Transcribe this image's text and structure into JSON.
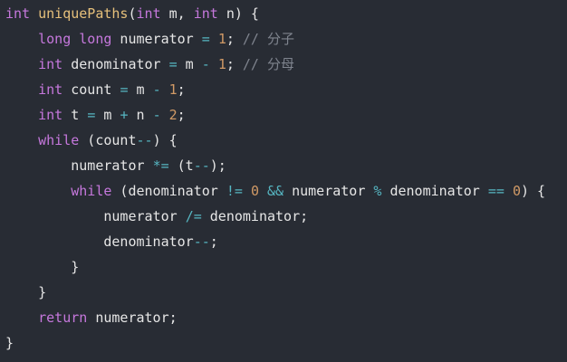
{
  "editor": {
    "language": "cpp",
    "colors": {
      "background": "#282c34",
      "keyword": "#c678dd",
      "function": "#e6c07b",
      "number": "#d19a66",
      "operator": "#56b6c2",
      "comment": "#7f848e",
      "plain": "#e6e6e6"
    },
    "lines": [
      {
        "indent": 0,
        "tokens": [
          {
            "t": "int",
            "c": "kw"
          },
          {
            "t": " ",
            "c": "pl"
          },
          {
            "t": "uniquePaths",
            "c": "fn"
          },
          {
            "t": "(",
            "c": "pl"
          },
          {
            "t": "int",
            "c": "kw"
          },
          {
            "t": " m, ",
            "c": "pl"
          },
          {
            "t": "int",
            "c": "kw"
          },
          {
            "t": " n) {",
            "c": "pl"
          }
        ]
      },
      {
        "indent": 1,
        "tokens": [
          {
            "t": "long",
            "c": "kw"
          },
          {
            "t": " ",
            "c": "pl"
          },
          {
            "t": "long",
            "c": "kw"
          },
          {
            "t": " numerator ",
            "c": "pl"
          },
          {
            "t": "=",
            "c": "op"
          },
          {
            "t": " ",
            "c": "pl"
          },
          {
            "t": "1",
            "c": "num"
          },
          {
            "t": "; ",
            "c": "pl"
          },
          {
            "t": "// 分子",
            "c": "cm"
          }
        ]
      },
      {
        "indent": 1,
        "tokens": [
          {
            "t": "int",
            "c": "kw"
          },
          {
            "t": " denominator ",
            "c": "pl"
          },
          {
            "t": "=",
            "c": "op"
          },
          {
            "t": " m ",
            "c": "pl"
          },
          {
            "t": "-",
            "c": "op"
          },
          {
            "t": " ",
            "c": "pl"
          },
          {
            "t": "1",
            "c": "num"
          },
          {
            "t": "; ",
            "c": "pl"
          },
          {
            "t": "// 分母",
            "c": "cm"
          }
        ]
      },
      {
        "indent": 1,
        "tokens": [
          {
            "t": "int",
            "c": "kw"
          },
          {
            "t": " count ",
            "c": "pl"
          },
          {
            "t": "=",
            "c": "op"
          },
          {
            "t": " m ",
            "c": "pl"
          },
          {
            "t": "-",
            "c": "op"
          },
          {
            "t": " ",
            "c": "pl"
          },
          {
            "t": "1",
            "c": "num"
          },
          {
            "t": ";",
            "c": "pl"
          }
        ]
      },
      {
        "indent": 1,
        "tokens": [
          {
            "t": "int",
            "c": "kw"
          },
          {
            "t": " t ",
            "c": "pl"
          },
          {
            "t": "=",
            "c": "op"
          },
          {
            "t": " m ",
            "c": "pl"
          },
          {
            "t": "+",
            "c": "op"
          },
          {
            "t": " n ",
            "c": "pl"
          },
          {
            "t": "-",
            "c": "op"
          },
          {
            "t": " ",
            "c": "pl"
          },
          {
            "t": "2",
            "c": "num"
          },
          {
            "t": ";",
            "c": "pl"
          }
        ]
      },
      {
        "indent": 1,
        "tokens": [
          {
            "t": "while",
            "c": "kw"
          },
          {
            "t": " (count",
            "c": "pl"
          },
          {
            "t": "--",
            "c": "op"
          },
          {
            "t": ") {",
            "c": "pl"
          }
        ]
      },
      {
        "indent": 2,
        "tokens": [
          {
            "t": "numerator ",
            "c": "pl"
          },
          {
            "t": "*=",
            "c": "op"
          },
          {
            "t": " (t",
            "c": "pl"
          },
          {
            "t": "--",
            "c": "op"
          },
          {
            "t": ");",
            "c": "pl"
          }
        ]
      },
      {
        "indent": 2,
        "tokens": [
          {
            "t": "while",
            "c": "kw"
          },
          {
            "t": " (denominator ",
            "c": "pl"
          },
          {
            "t": "!=",
            "c": "op"
          },
          {
            "t": " ",
            "c": "pl"
          },
          {
            "t": "0",
            "c": "num"
          },
          {
            "t": " ",
            "c": "pl"
          },
          {
            "t": "&&",
            "c": "op"
          },
          {
            "t": " numerator ",
            "c": "pl"
          },
          {
            "t": "%",
            "c": "op"
          },
          {
            "t": " denominator ",
            "c": "pl"
          },
          {
            "t": "==",
            "c": "op"
          },
          {
            "t": " ",
            "c": "pl"
          },
          {
            "t": "0",
            "c": "num"
          },
          {
            "t": ") {",
            "c": "pl"
          }
        ]
      },
      {
        "indent": 3,
        "tokens": [
          {
            "t": "numerator ",
            "c": "pl"
          },
          {
            "t": "/=",
            "c": "op"
          },
          {
            "t": " denominator;",
            "c": "pl"
          }
        ]
      },
      {
        "indent": 3,
        "tokens": [
          {
            "t": "denominator",
            "c": "pl"
          },
          {
            "t": "--",
            "c": "op"
          },
          {
            "t": ";",
            "c": "pl"
          }
        ]
      },
      {
        "indent": 2,
        "tokens": [
          {
            "t": "}",
            "c": "pl"
          }
        ]
      },
      {
        "indent": 1,
        "tokens": [
          {
            "t": "}",
            "c": "pl"
          }
        ]
      },
      {
        "indent": 1,
        "tokens": [
          {
            "t": "return",
            "c": "kw"
          },
          {
            "t": " numerator;",
            "c": "pl"
          }
        ]
      },
      {
        "indent": 0,
        "tokens": [
          {
            "t": "}",
            "c": "pl"
          }
        ]
      }
    ]
  }
}
